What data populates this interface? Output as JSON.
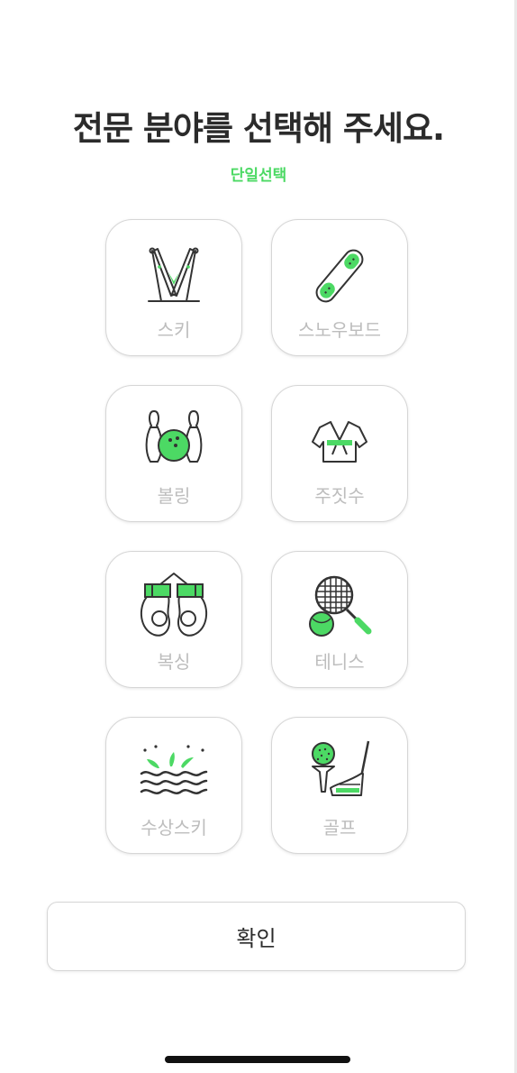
{
  "header": {
    "title": "전문 분야를 선택해 주세요.",
    "subtitle": "단일선택"
  },
  "sports": [
    {
      "label": "스키",
      "icon": "ski-icon"
    },
    {
      "label": "스노우보드",
      "icon": "snowboard-icon"
    },
    {
      "label": "볼링",
      "icon": "bowling-icon"
    },
    {
      "label": "주짓수",
      "icon": "jiujitsu-gi-icon"
    },
    {
      "label": "복싱",
      "icon": "boxing-gloves-icon"
    },
    {
      "label": "테니스",
      "icon": "tennis-racket-icon"
    },
    {
      "label": "수상스키",
      "icon": "water-ski-icon"
    },
    {
      "label": "골프",
      "icon": "golf-icon"
    }
  ],
  "footer": {
    "confirm_label": "확인"
  },
  "colors": {
    "accent": "#4cd964",
    "title": "#2b2b2b",
    "label_inactive": "#bdbdbd",
    "border": "#d6d6d6"
  }
}
